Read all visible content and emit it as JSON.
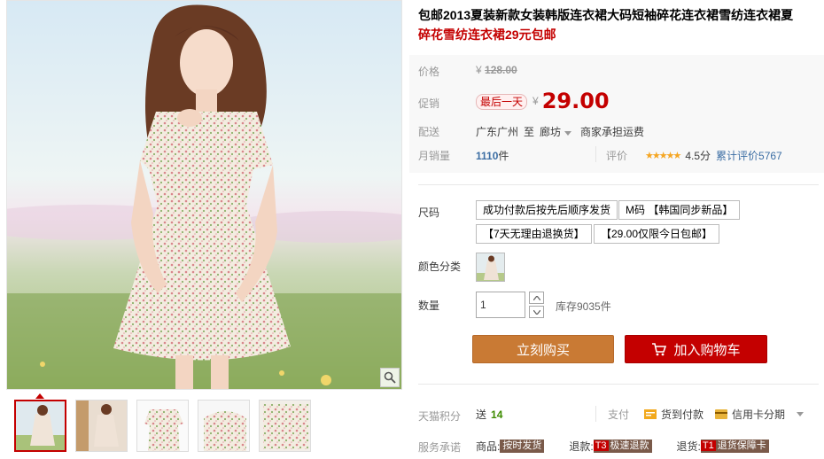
{
  "product": {
    "title_line1": "包邮2013夏装新款女装韩版连衣裙大码短袖碎花连衣裙雪纺连衣裙夏",
    "title_line2": "碎花雪纺连衣裙29元包邮"
  },
  "price": {
    "label": "价格",
    "currency": "¥",
    "original": "128.00"
  },
  "promo": {
    "label": "促销",
    "tag": "最后一天",
    "currency": "¥",
    "price": "29.00"
  },
  "shipping": {
    "label": "配送",
    "from": "广东广州",
    "to_word": "至",
    "destination": "廊坊",
    "fee_text": "商家承担运费"
  },
  "sales": {
    "label": "月销量",
    "count": "1110",
    "unit": "件"
  },
  "rating": {
    "label": "评价",
    "stars": "★★★★★",
    "score": "4.5分",
    "total": "累计评价5767"
  },
  "sku": {
    "size_label": "尺码",
    "sizes": [
      "成功付款后按先后顺序发货",
      "M码 【韩国同步新品】",
      "【7天无理由退换货】",
      "【29.00仅限今日包邮】"
    ],
    "color_label": "颜色分类"
  },
  "quantity": {
    "label": "数量",
    "value": "1",
    "stock": "库存9035件"
  },
  "buttons": {
    "buy_now": "立刻购买",
    "add_to_cart": "加入购物车"
  },
  "points": {
    "label": "天猫积分",
    "prefix": "送",
    "value": "14"
  },
  "payment": {
    "label": "支付",
    "cod": "货到付款",
    "credit": "信用卡分期"
  },
  "service": {
    "label": "服务承诺",
    "goods_label": "商品:",
    "goods_tag": "按时发货",
    "refund_label": "退款:",
    "refund_code": "T3",
    "refund_tag": "极速退款",
    "return_label": "退货:",
    "return_code": "T1",
    "return_tag": "退货保障卡"
  },
  "icons": {
    "zoom": "magnifier-icon",
    "cart": "shopping-cart-icon",
    "cod": "cod-icon",
    "credit": "credit-card-icon"
  },
  "colors": {
    "brand_red": "#c40000",
    "buy_orange": "#c97a34",
    "link_blue": "#3c6ea4"
  }
}
